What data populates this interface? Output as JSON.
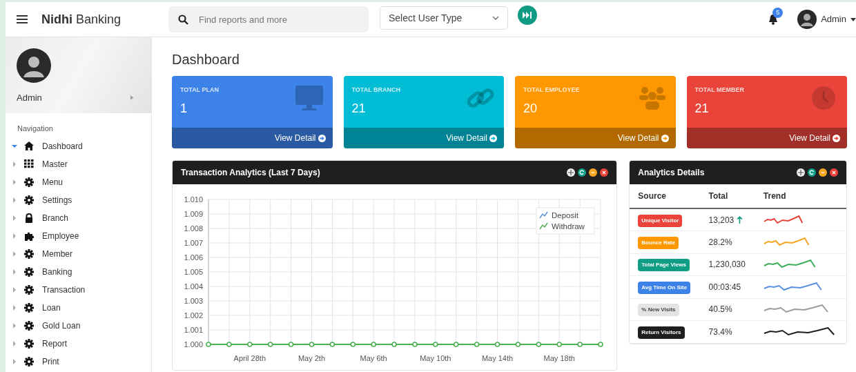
{
  "header": {
    "brand": "**Nidhi** Banking",
    "search": {
      "placeholder": "Find reports and more"
    },
    "user_type_select": {
      "value": "Select User Type"
    },
    "notifications": {
      "count": "5"
    },
    "user": {
      "name": "Admin"
    }
  },
  "sidebar": {
    "profile": {
      "name": "Admin"
    },
    "heading": "Navigation",
    "items": [
      {
        "label": "Dashboard",
        "kind": "home",
        "expanded": true
      },
      {
        "label": "Master",
        "kind": "grid",
        "expanded": false
      },
      {
        "label": "Menu",
        "kind": "gear",
        "expanded": false
      },
      {
        "label": "Settings",
        "kind": "gear",
        "expanded": false
      },
      {
        "label": "Branch",
        "kind": "lock",
        "expanded": false
      },
      {
        "label": "Employee",
        "kind": "puzzle",
        "expanded": false
      },
      {
        "label": "Member",
        "kind": "gear",
        "expanded": false
      },
      {
        "label": "Banking",
        "kind": "gear",
        "expanded": false
      },
      {
        "label": "Transaction",
        "kind": "gear",
        "expanded": false
      },
      {
        "label": "Loan",
        "kind": "gear",
        "expanded": false
      },
      {
        "label": "Gold Loan",
        "kind": "gear",
        "expanded": false
      },
      {
        "label": "Report",
        "kind": "gear",
        "expanded": false
      },
      {
        "label": "Print",
        "kind": "gear",
        "expanded": false
      }
    ]
  },
  "page_title": "Dashboard",
  "stat_cards": [
    {
      "label": "TOTAL PLAN",
      "value": "1",
      "link": "View Detail",
      "kind": "monitor",
      "color": "#3d82e8"
    },
    {
      "label": "TOTAL BRANCH",
      "value": "21",
      "link": "View Detail",
      "kind": "link",
      "color": "#00bcd4"
    },
    {
      "label": "TOTAL EMPLOYEE",
      "value": "20",
      "link": "View Detail",
      "kind": "people",
      "color": "#ff9800"
    },
    {
      "label": "TOTAL MEMBER",
      "value": "21",
      "link": "View Detail",
      "kind": "clock",
      "color": "#e9433a"
    }
  ],
  "transaction_panel": {
    "title": "Transaction Analytics (Last 7 Days)",
    "chart_data": {
      "type": "line",
      "categories": [
        null,
        null,
        "April 28th",
        null,
        null,
        "May 2th",
        null,
        null,
        "May 6th",
        null,
        null,
        "May 10th",
        null,
        null,
        "May 14th",
        null,
        null,
        "May 18th",
        null,
        null
      ],
      "series": [
        {
          "name": "Deposit",
          "color": "#5b8fd6",
          "marker": "circle",
          "values": [
            null,
            null,
            null,
            null,
            null,
            null,
            null,
            null,
            null,
            null,
            null,
            null,
            null,
            null,
            null,
            null,
            null,
            null,
            null,
            null
          ]
        },
        {
          "name": "Withdraw",
          "color": "#4caf50",
          "marker": "circle",
          "values": [
            1,
            1,
            1,
            1,
            1,
            1,
            1,
            1,
            1,
            1,
            1,
            1,
            1,
            1,
            1,
            1,
            1,
            1,
            1,
            1
          ]
        }
      ],
      "grid": true,
      "legend": true,
      "ylim": [
        1.0,
        1.01
      ],
      "yticks": [
        {
          "value": 1.0,
          "label": "1.000"
        },
        {
          "value": 1.001,
          "label": "1.001"
        },
        {
          "value": 1.002,
          "label": "1.002"
        },
        {
          "value": 1.003,
          "label": "1.003"
        },
        {
          "value": 1.004,
          "label": "1.004"
        },
        {
          "value": 1.005,
          "label": "1.005"
        },
        {
          "value": 1.006,
          "label": "1.006"
        },
        {
          "value": 1.007,
          "label": "1.007"
        },
        {
          "value": 1.008,
          "label": "1.008"
        },
        {
          "value": 1.009,
          "label": "1.009"
        },
        {
          "value": 1.01,
          "label": "1.010"
        }
      ]
    }
  },
  "analytics_panel": {
    "title": "Analytics Details",
    "columns": [
      "Source",
      "Total",
      "Trend"
    ],
    "rows": [
      {
        "source": "Unique Visitor",
        "total": "13,203",
        "trend_up": true,
        "color": "#e9433a",
        "trend": {
          "color": "#e9433a"
        }
      },
      {
        "source": "Bounce Rate",
        "total": "28.2%",
        "trend_up": false,
        "color": "#ff9800",
        "trend": {
          "color": "#f5a623"
        }
      },
      {
        "source": "Total Page Views",
        "total": "1,230,030",
        "trend_up": false,
        "color": "#0f9d84",
        "trend": {
          "color": "#3dae5a"
        }
      },
      {
        "source": "Avg Time On Site",
        "total": "00:03:45",
        "trend_up": false,
        "color": "#3d82e8",
        "trend": {
          "color": "#5b8fe0"
        }
      },
      {
        "source": "% New Visits",
        "total": "40.5%",
        "trend_up": false,
        "color": "#e4e4e4",
        "trend": {
          "color": "#9a9a9a"
        }
      },
      {
        "source": "Return Visitors",
        "total": "73.4%",
        "trend_up": false,
        "color": "#1e1e1e",
        "trend": {
          "color": "#1e1e1e"
        }
      }
    ]
  }
}
